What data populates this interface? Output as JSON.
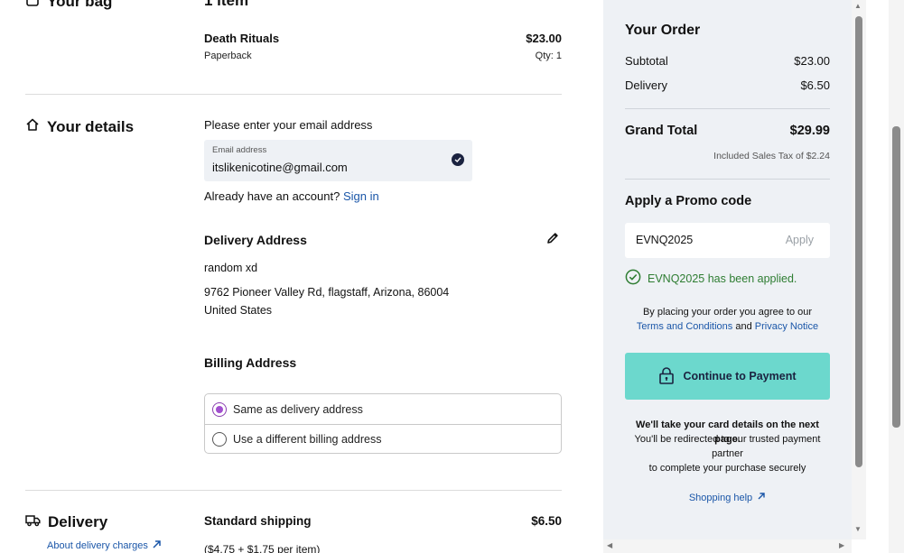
{
  "bag": {
    "title": "Your bag",
    "item_count": "1 item",
    "item_name": "Death Rituals",
    "item_format": "Paperback",
    "item_price": "$23.00",
    "item_qty": "Qty: 1"
  },
  "details": {
    "title": "Your details",
    "email_prompt": "Please enter your email address",
    "email_label": "Email address",
    "email_value": "itslikenicotine@gmail.com",
    "account_question": "Already have an account?",
    "sign_in": "Sign in",
    "delivery_address_title": "Delivery Address",
    "address_name": "random xd",
    "address_line": "9762 Pioneer Valley Rd, flagstaff, Arizona, 86004 United States",
    "billing_title": "Billing Address",
    "billing_options": [
      "Same as delivery address",
      "Use a different billing address"
    ],
    "billing_selected": "Same as delivery address"
  },
  "delivery": {
    "title": "Delivery",
    "about_link": "About delivery charges",
    "method": "Standard shipping",
    "price": "$6.50",
    "breakdown": "($4.75 + $1.75 per item)"
  },
  "order": {
    "title": "Your Order",
    "subtotal_label": "Subtotal",
    "subtotal_value": "$23.00",
    "delivery_label": "Delivery",
    "delivery_value": "$6.50",
    "grand_total_label": "Grand Total",
    "grand_total_value": "$29.99",
    "tax_note": "Included Sales Tax of $2.24",
    "promo_title": "Apply a Promo code",
    "promo_value": "EVNQ2025",
    "promo_apply": "Apply",
    "promo_success": "EVNQ2025 has been applied.",
    "agree_text": "By placing your order you agree to our",
    "terms_link": "Terms and Conditions",
    "and_text": "and",
    "privacy_link": "Privacy Notice",
    "pay_button": "Continue to Payment",
    "card_note_bold": "We'll take your card details on the next page.",
    "redirect_note": "You'll be redirected to our trusted payment partner",
    "secure_note": "to complete your purchase securely",
    "help_link": "Shopping help"
  },
  "colors": {
    "accent_teal": "#6cd8cd",
    "link_blue": "#1a56a8",
    "success_green": "#2e7d32",
    "radio_purple": "#a24fcf",
    "panel_bg": "#eef1f5"
  },
  "icons": [
    "bag-icon",
    "home-icon",
    "check-circle-icon",
    "edit-pencil-icon",
    "truck-icon",
    "external-arrow-icon",
    "lock-icon",
    "success-check-icon"
  ]
}
